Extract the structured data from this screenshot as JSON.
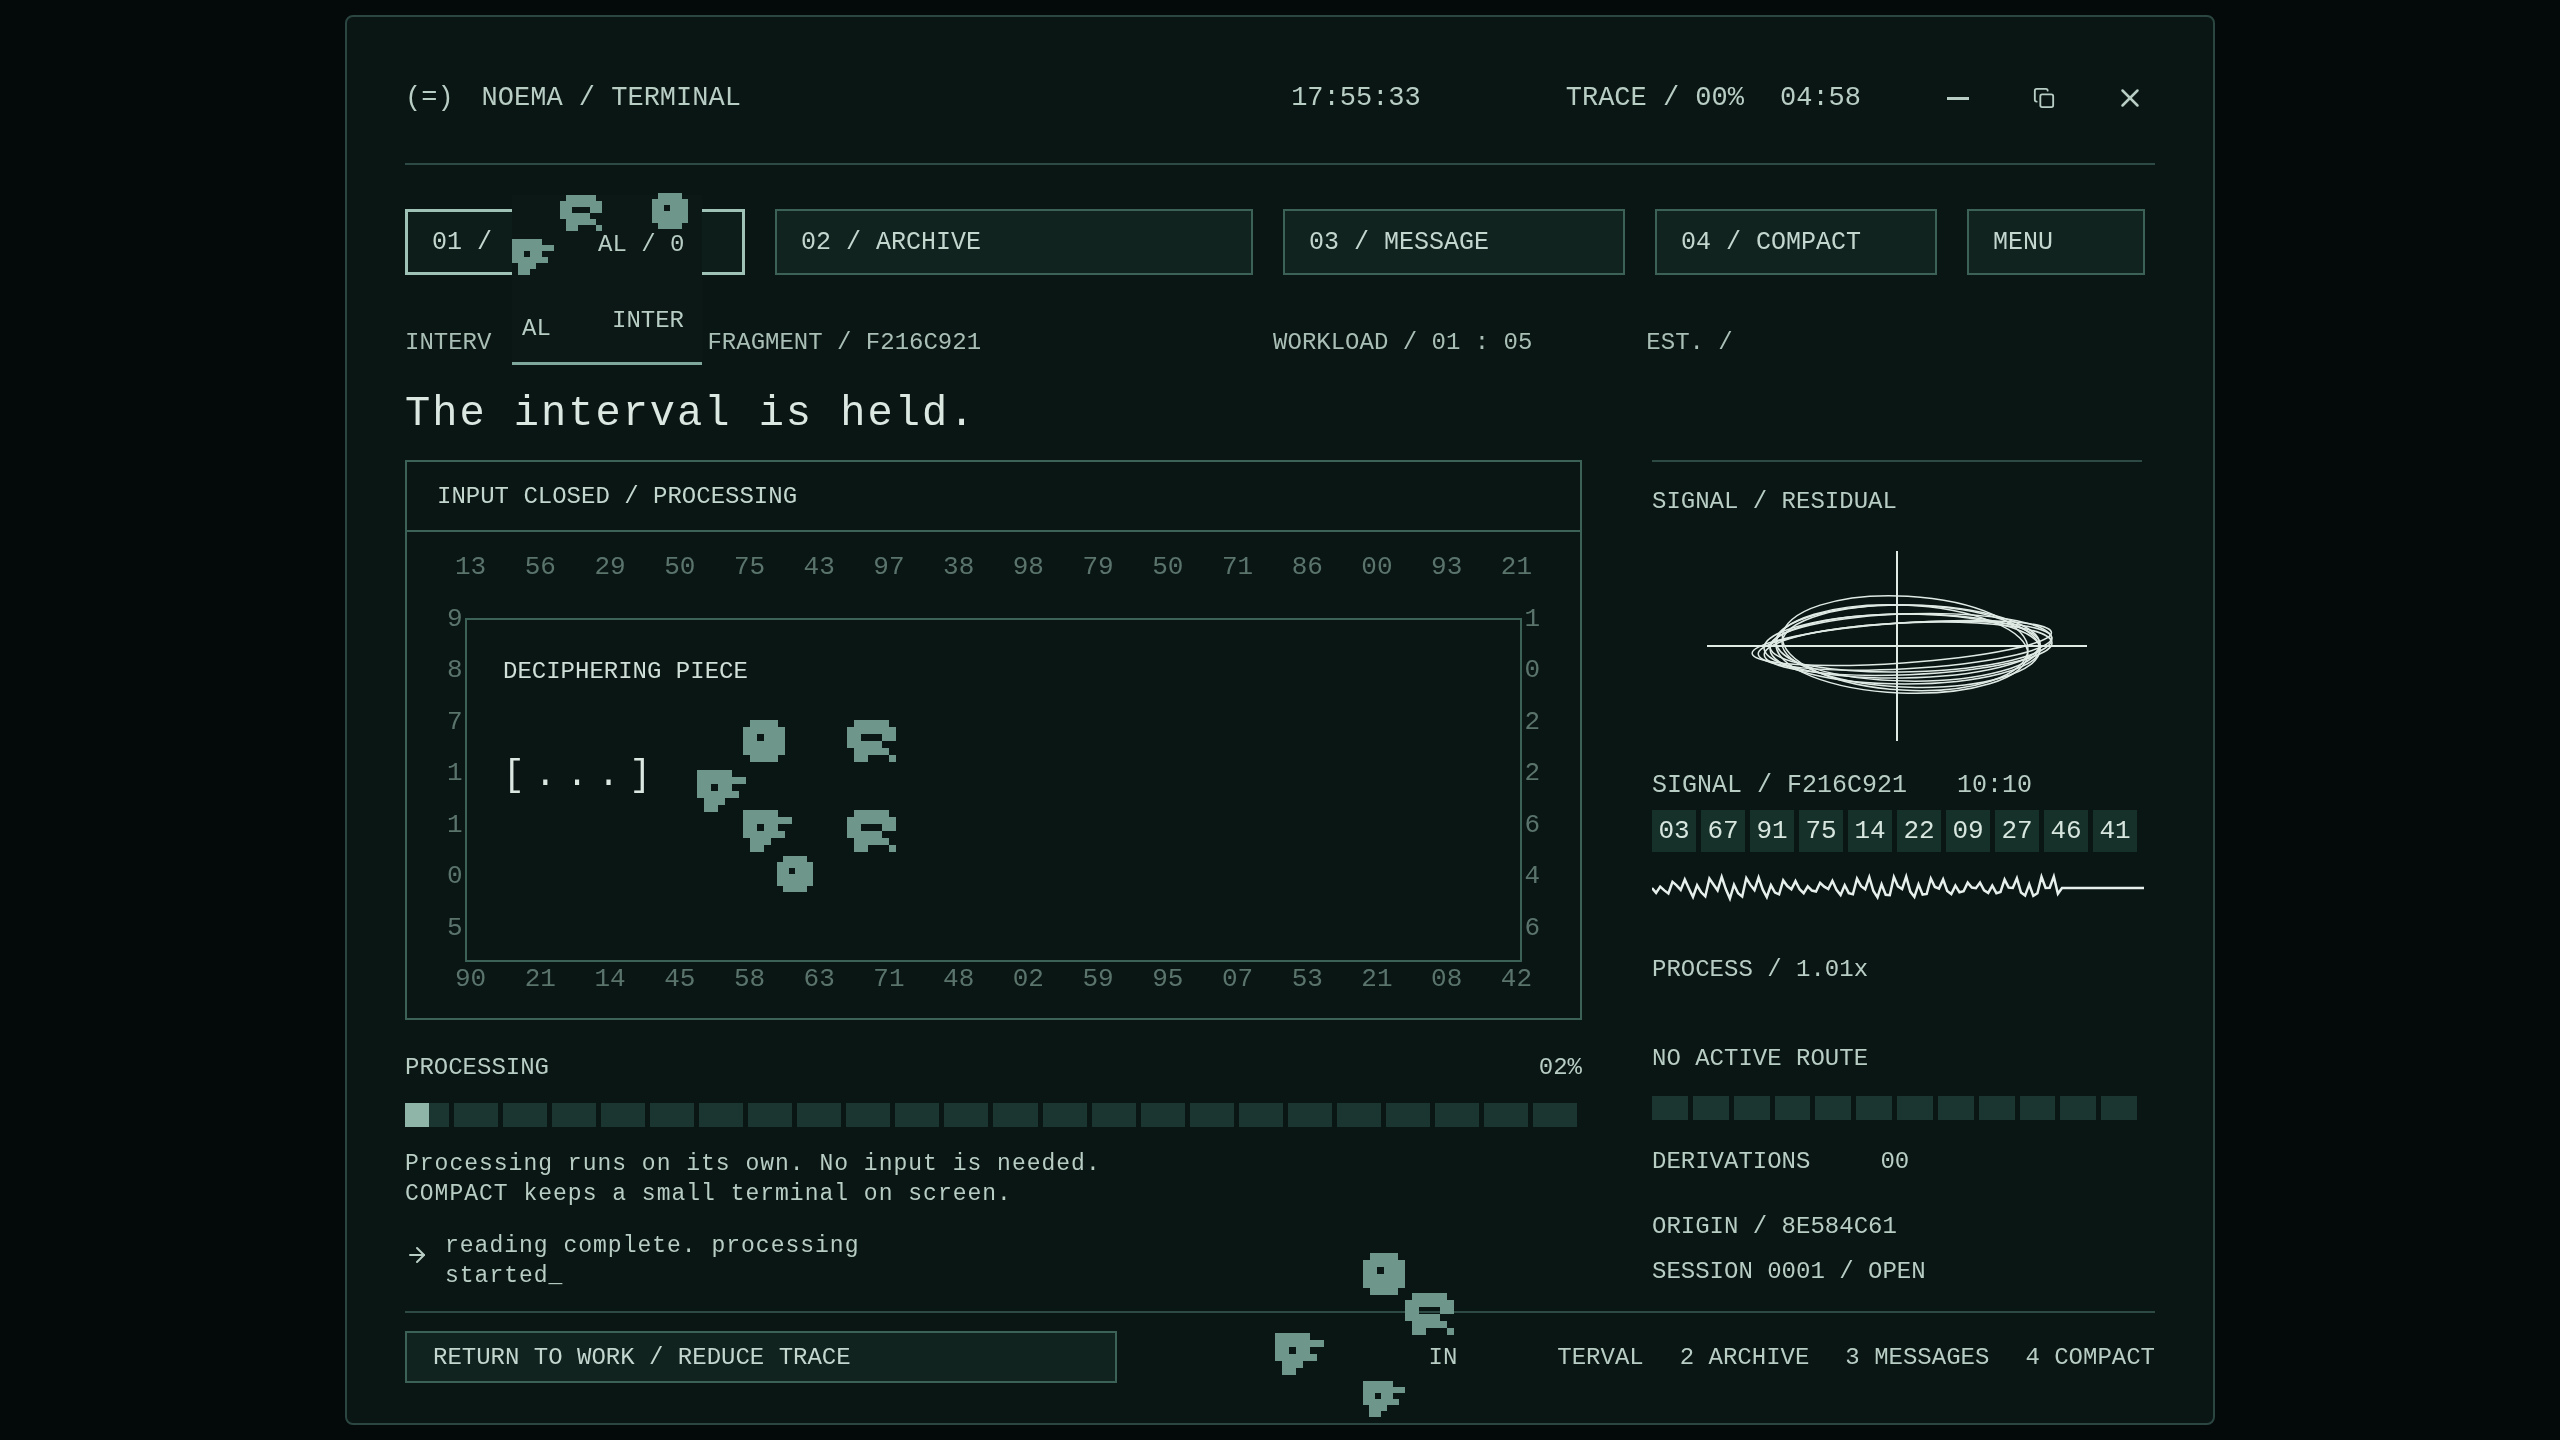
{
  "window": {
    "icon": "(=)",
    "title": "NOEMA / TERMINAL",
    "clock": "17:55:33",
    "trace": "TRACE / 00%",
    "timer": "04:58"
  },
  "tabs": [
    {
      "label": "01 /",
      "selected": true
    },
    {
      "label": "02 / ARCHIVE",
      "selected": false
    },
    {
      "label": "03 / MESSAGE",
      "selected": false
    },
    {
      "label": "04 / COMPACT",
      "selected": false
    }
  ],
  "menu": "MENU",
  "glitch": {
    "tab_fragment": "AL / 0",
    "fragments": [
      "AL",
      "INTER"
    ]
  },
  "status": [
    "INTERV",
    "FRAGMENT / F216C921",
    "WORKLOAD / 01 : 05",
    "EST. /"
  ],
  "headline": "The interval is held.",
  "input_panel": {
    "title": "INPUT CLOSED / PROCESSING",
    "first_row": [
      "13",
      "56",
      "29",
      "50",
      "75",
      "43",
      "97",
      "38",
      "98",
      "79",
      "50",
      "71",
      "86",
      "00",
      "93",
      "21"
    ],
    "edge_rows": [
      [
        "9",
        "1"
      ],
      [
        "8",
        "0"
      ],
      [
        "7",
        "2"
      ],
      [
        "1",
        "2"
      ],
      [
        "1",
        "6"
      ],
      [
        "0",
        "4"
      ],
      [
        "5",
        "6"
      ]
    ],
    "last_row": [
      "90",
      "21",
      "14",
      "45",
      "58",
      "63",
      "71",
      "48",
      "02",
      "59",
      "95",
      "07",
      "53",
      "21",
      "08",
      "42"
    ],
    "dialog": {
      "title": "DECIPHERING PIECE",
      "text": "[...]"
    }
  },
  "processing": {
    "label": "PROCESSING",
    "percent": "02%",
    "level": 0.02,
    "note": [
      "Processing runs on its own. No input is needed.",
      "COMPACT keeps a small terminal on screen."
    ],
    "log": "reading complete. processing started_"
  },
  "signal": {
    "title": "SIGNAL / RESIDUAL",
    "id": "SIGNAL / F216C921",
    "time": "10:10",
    "codes": [
      "03",
      "67",
      "91",
      "75",
      "14",
      "22",
      "09",
      "27",
      "46",
      "41"
    ],
    "process": "PROCESS / 1.01x",
    "route": {
      "label": "NO ACTIVE ROUTE"
    },
    "derivations": {
      "label": "DERIVATIONS",
      "value": "00"
    },
    "origin": "ORIGIN / 8E584C61",
    "session": "SESSION 0001 / OPEN"
  },
  "footer": {
    "button": "RETURN TO WORK / REDUCE TRACE",
    "nav": [
      "IN",
      "TERVAL",
      "2 ARCHIVE",
      "3 MESSAGES",
      "4 COMPACT"
    ]
  }
}
